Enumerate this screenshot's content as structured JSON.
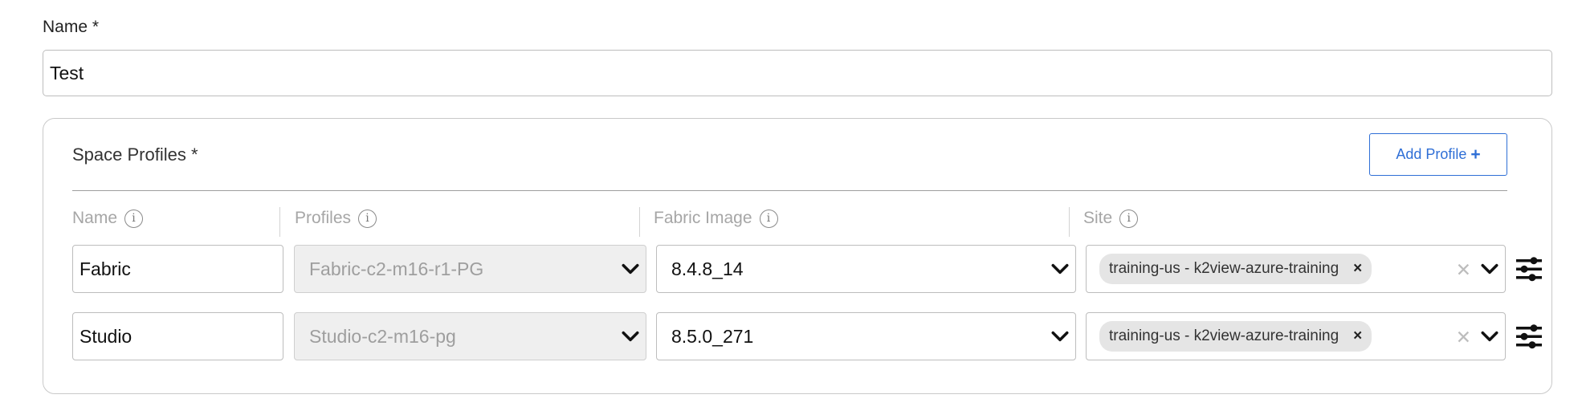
{
  "form": {
    "name_label": "Name *",
    "name_value": "Test"
  },
  "profiles_panel": {
    "title": "Space Profiles *",
    "add_button_label": "Add Profile",
    "add_button_icon": "+",
    "columns": {
      "name": "Name",
      "profiles": "Profiles",
      "fabric_image": "Fabric Image",
      "site": "Site"
    },
    "rows": [
      {
        "name": "Fabric",
        "profile": "Fabric-c2-m16-r1-PG",
        "fabric_image": "8.4.8_14",
        "site_chip": "training-us - k2view-azure-training"
      },
      {
        "name": "Studio",
        "profile": "Studio-c2-m16-pg",
        "fabric_image": "8.5.0_271",
        "site_chip": "training-us - k2view-azure-training"
      }
    ]
  },
  "icons": {
    "info": "info-icon",
    "chevron": "chevron-down-icon",
    "chip_remove": "×",
    "clear": "✕",
    "settings": "sliders-icon"
  },
  "colors": {
    "accent": "#2f6fd6",
    "disabled_bg": "#efefef",
    "chip_bg": "#e5e5e5"
  }
}
